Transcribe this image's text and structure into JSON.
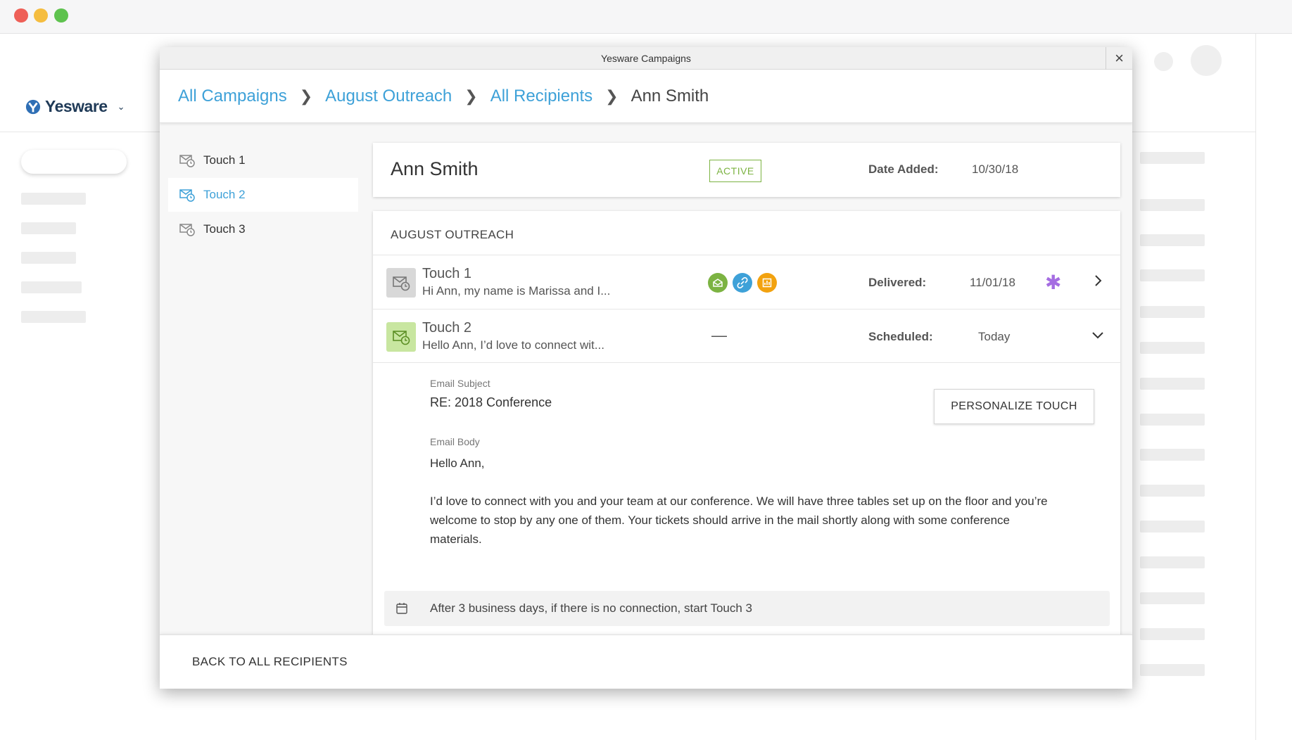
{
  "app": {
    "brand": "Yesware"
  },
  "modal": {
    "title": "Yesware Campaigns",
    "close": "×"
  },
  "breadcrumb": [
    {
      "label": "All Campaigns"
    },
    {
      "label": "August Outreach"
    },
    {
      "label": "All Recipients"
    },
    {
      "label": "Ann Smith"
    }
  ],
  "nav": {
    "items": [
      {
        "label": "Touch 1",
        "active": false
      },
      {
        "label": "Touch 2",
        "active": true
      },
      {
        "label": "Touch 3",
        "active": false
      }
    ]
  },
  "recipient": {
    "name": "Ann Smith",
    "status": "ACTIVE",
    "date_added_label": "Date Added:",
    "date_added": "10/30/18"
  },
  "campaign": {
    "title": "AUGUST OUTREACH",
    "touches": [
      {
        "title": "Touch 1",
        "preview": "Hi Ann, my name is Marissa and I...",
        "status_label": "Delivered:",
        "status_value": "11/01/18",
        "stat_icons": [
          "opened-icon",
          "link-clicked-icon",
          "attachment-viewed-icon"
        ],
        "stat_colors": [
          "#7cb342",
          "#3ea1d8",
          "#f2a20f"
        ]
      },
      {
        "title": "Touch 2",
        "preview": "Hello Ann, I’d love to connect wit...",
        "stats_placeholder": "—",
        "status_label": "Scheduled:",
        "status_value": "Today"
      }
    ],
    "detail": {
      "subject_label": "Email Subject",
      "subject": "RE: 2018 Conference",
      "body_label": "Email Body",
      "body_greeting": "Hello Ann,",
      "body_paragraph": "I’d love to connect with you and your team at our conference. We will have three tables set up on the floor and you’re welcome to stop by any one of them. Your tickets should arrive in the mail shortly along with some conference materials.",
      "personalize_label": "PERSONALIZE TOUCH",
      "rule_text": "After 3 business days, if there is no connection, start Touch 3"
    }
  },
  "footer": {
    "back_label": "BACK TO ALL RECIPIENTS"
  },
  "colors": {
    "accent": "#3ea1d8",
    "active": "#7cb342",
    "asterisk": "#a56de2"
  }
}
